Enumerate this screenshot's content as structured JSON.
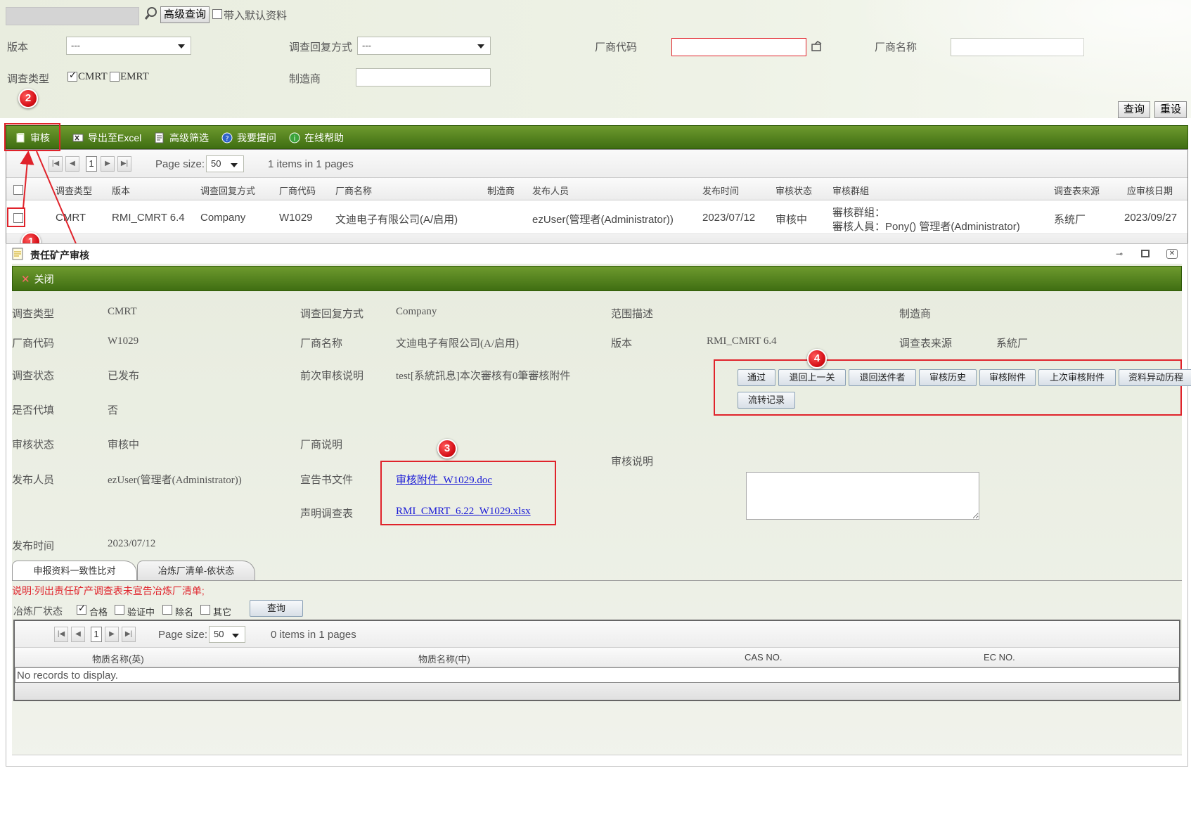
{
  "search": {
    "advanced_button": "高级查询",
    "default_data_label": "带入默认资料",
    "version_label": "版本",
    "version_value": "---",
    "reply_mode_label": "调查回复方式",
    "reply_mode_value": "---",
    "vendor_code_label": "厂商代码",
    "vendor_name_label": "厂商名称",
    "survey_type_label": "调查类型",
    "cmrt_label": "CMRT",
    "emrt_label": "EMRT",
    "manufacturer_label": "制造商",
    "query_button": "查询",
    "reset_button": "重设"
  },
  "toolbar": {
    "review": "审核",
    "export_excel": "导出至Excel",
    "advanced_filter": "高级筛选",
    "ask_question": "我要提问",
    "online_help": "在线帮助"
  },
  "pager_top": {
    "page": "1",
    "page_size_label": "Page size:",
    "page_size": "50",
    "summary": "1 items in 1 pages"
  },
  "grid": {
    "columns": [
      "调查类型",
      "版本",
      "调查回复方式",
      "厂商代码",
      "厂商名称",
      "制造商",
      "发布人员",
      "发布时间",
      "审核状态",
      "审核群組",
      "调查表来源",
      "应审核日期"
    ],
    "row": {
      "type": "CMRT",
      "version": "RMI_CMRT 6.4",
      "reply": "Company",
      "code": "W1029",
      "name": "文迪电子有限公司(A/启用)",
      "manufacturer": "",
      "publisher": "ezUser(管理者(Administrator))",
      "publish_time": "2023/07/12",
      "status": "审核中",
      "group_line1": "審核群組：",
      "group_line2": "審核人員：Pony() 管理者(Administrator)",
      "source": "系统厂",
      "due_date": "2023/09/27"
    }
  },
  "badges": {
    "b1": "1",
    "b2": "2",
    "b3": "3",
    "b4": "4"
  },
  "dialog": {
    "title": "责任矿产审核",
    "close_label": "关闭",
    "fields": {
      "survey_type_label": "调查类型",
      "survey_type": "CMRT",
      "reply_mode_label": "调查回复方式",
      "reply_mode": "Company",
      "scope_label": "范围描述",
      "manufacturer_label": "制造商",
      "vendor_code_label": "厂商代码",
      "vendor_code": "W1029",
      "vendor_name_label": "厂商名称",
      "vendor_name": "文迪电子有限公司(A/启用)",
      "version_label": "版本",
      "version": "RMI_CMRT 6.4",
      "source_label": "调查表来源",
      "source": "系統厂",
      "survey_status_label": "调查状态",
      "survey_status": "已发布",
      "prev_review_label": "前次审核说明",
      "prev_review": "test[系統訊息]本次審核有0筆審核附件",
      "proxy_label": "是否代填",
      "proxy": "否",
      "review_status_label": "审核状态",
      "review_status": "审核中",
      "vendor_note_label": "厂商说明",
      "review_note_label": "审核说明",
      "publisher_label": "发布人员",
      "publisher": "ezUser(管理者(Administrator))",
      "declaration_label": "宣告书文件",
      "declaration_file": "审核附件_W1029.doc",
      "statement_label": "声明调查表",
      "statement_file": "RMI_CMRT_6.22_W1029.xlsx",
      "publish_time_label": "发布时间",
      "publish_time": "2023/07/12"
    },
    "actions": [
      "通过",
      "退回上一关",
      "退回送件者",
      "审核历史",
      "审核附件",
      "上次审核附件",
      "资料异动历程",
      "流转记录"
    ],
    "tabs": [
      "申报资料一致性比对",
      "冶炼厂清单-依状态"
    ],
    "note": "说明:列出责任矿产调查表未宣告冶炼厂清单;",
    "smelter_status_label": "冶炼厂状态",
    "status_options": [
      "合格",
      "验证中",
      "除名",
      "其它"
    ],
    "query_button": "查询",
    "pager": {
      "page": "1",
      "page_size_label": "Page size:",
      "page_size": "50",
      "summary": "0 items in 1 pages"
    },
    "sub_columns": [
      "物质名称(英)",
      "物质名称(中)",
      "CAS NO.",
      "EC NO."
    ],
    "no_records": "No records to display."
  }
}
